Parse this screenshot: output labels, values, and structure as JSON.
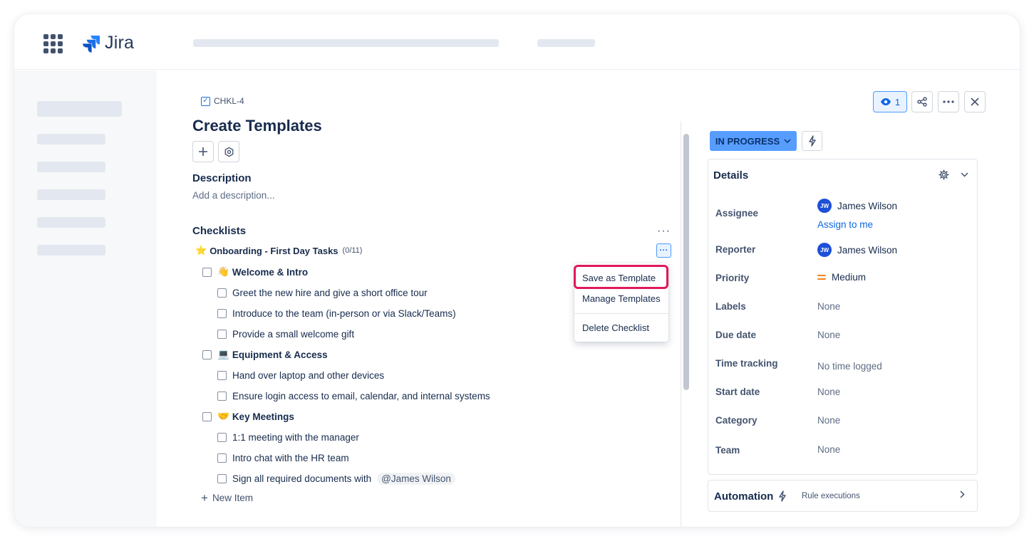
{
  "app": {
    "logo_text": "Jira"
  },
  "issue": {
    "key": "CHKL-4",
    "title": "Create Templates",
    "description_heading": "Description",
    "description_placeholder": "Add a description..."
  },
  "checklists": {
    "heading": "Checklists",
    "menu_dots": "···",
    "list": {
      "emoji": "⭐",
      "title": "Onboarding - First Day Tasks",
      "progress": "(0/11)",
      "menu_button": "···"
    },
    "groups": [
      {
        "emoji": "👋",
        "label": "Welcome & Intro",
        "items": [
          "Greet the new hire and give a short office tour",
          "Introduce to the team (in-person or via Slack/Teams)",
          "Provide a small welcome gift"
        ]
      },
      {
        "emoji": "💻",
        "label": "Equipment & Access",
        "items": [
          "Hand over laptop and other devices",
          "Ensure login access to email, calendar, and internal systems"
        ]
      },
      {
        "emoji": "🤝",
        "label": "Key Meetings",
        "items": [
          "1:1 meeting with the manager",
          "Intro chat with the HR team",
          "Sign all required documents with"
        ]
      }
    ],
    "mention": "@James Wilson",
    "new_item_label": "New Item"
  },
  "dropdown": {
    "items": [
      "Save as Template",
      "Manage Templates",
      "Delete Checklist"
    ],
    "highlighted": "Save as Template"
  },
  "toolbar": {
    "watch_count": "1"
  },
  "status": {
    "label": "IN PROGRESS"
  },
  "details": {
    "heading": "Details",
    "assignee": {
      "label": "Assignee",
      "initials": "JW",
      "name": "James Wilson",
      "assign_link": "Assign to me"
    },
    "reporter": {
      "label": "Reporter",
      "initials": "JW",
      "name": "James Wilson"
    },
    "priority": {
      "label": "Priority",
      "value": "Medium"
    },
    "labels": {
      "label": "Labels",
      "value": "None"
    },
    "due_date": {
      "label": "Due date",
      "value": "None"
    },
    "time_tracking": {
      "label": "Time tracking",
      "value": "No time logged"
    },
    "start_date": {
      "label": "Start date",
      "value": "None"
    },
    "category": {
      "label": "Category",
      "value": "None"
    },
    "team": {
      "label": "Team",
      "value": "None"
    }
  },
  "automation": {
    "heading": "Automation",
    "subtitle": "Rule executions"
  },
  "colors": {
    "accent": "#0c66e4",
    "status_bg": "#579dff",
    "highlight_ring": "#e0185a",
    "avatar_bg": "#1d4fd8",
    "priority_medium": "#f5851f"
  }
}
